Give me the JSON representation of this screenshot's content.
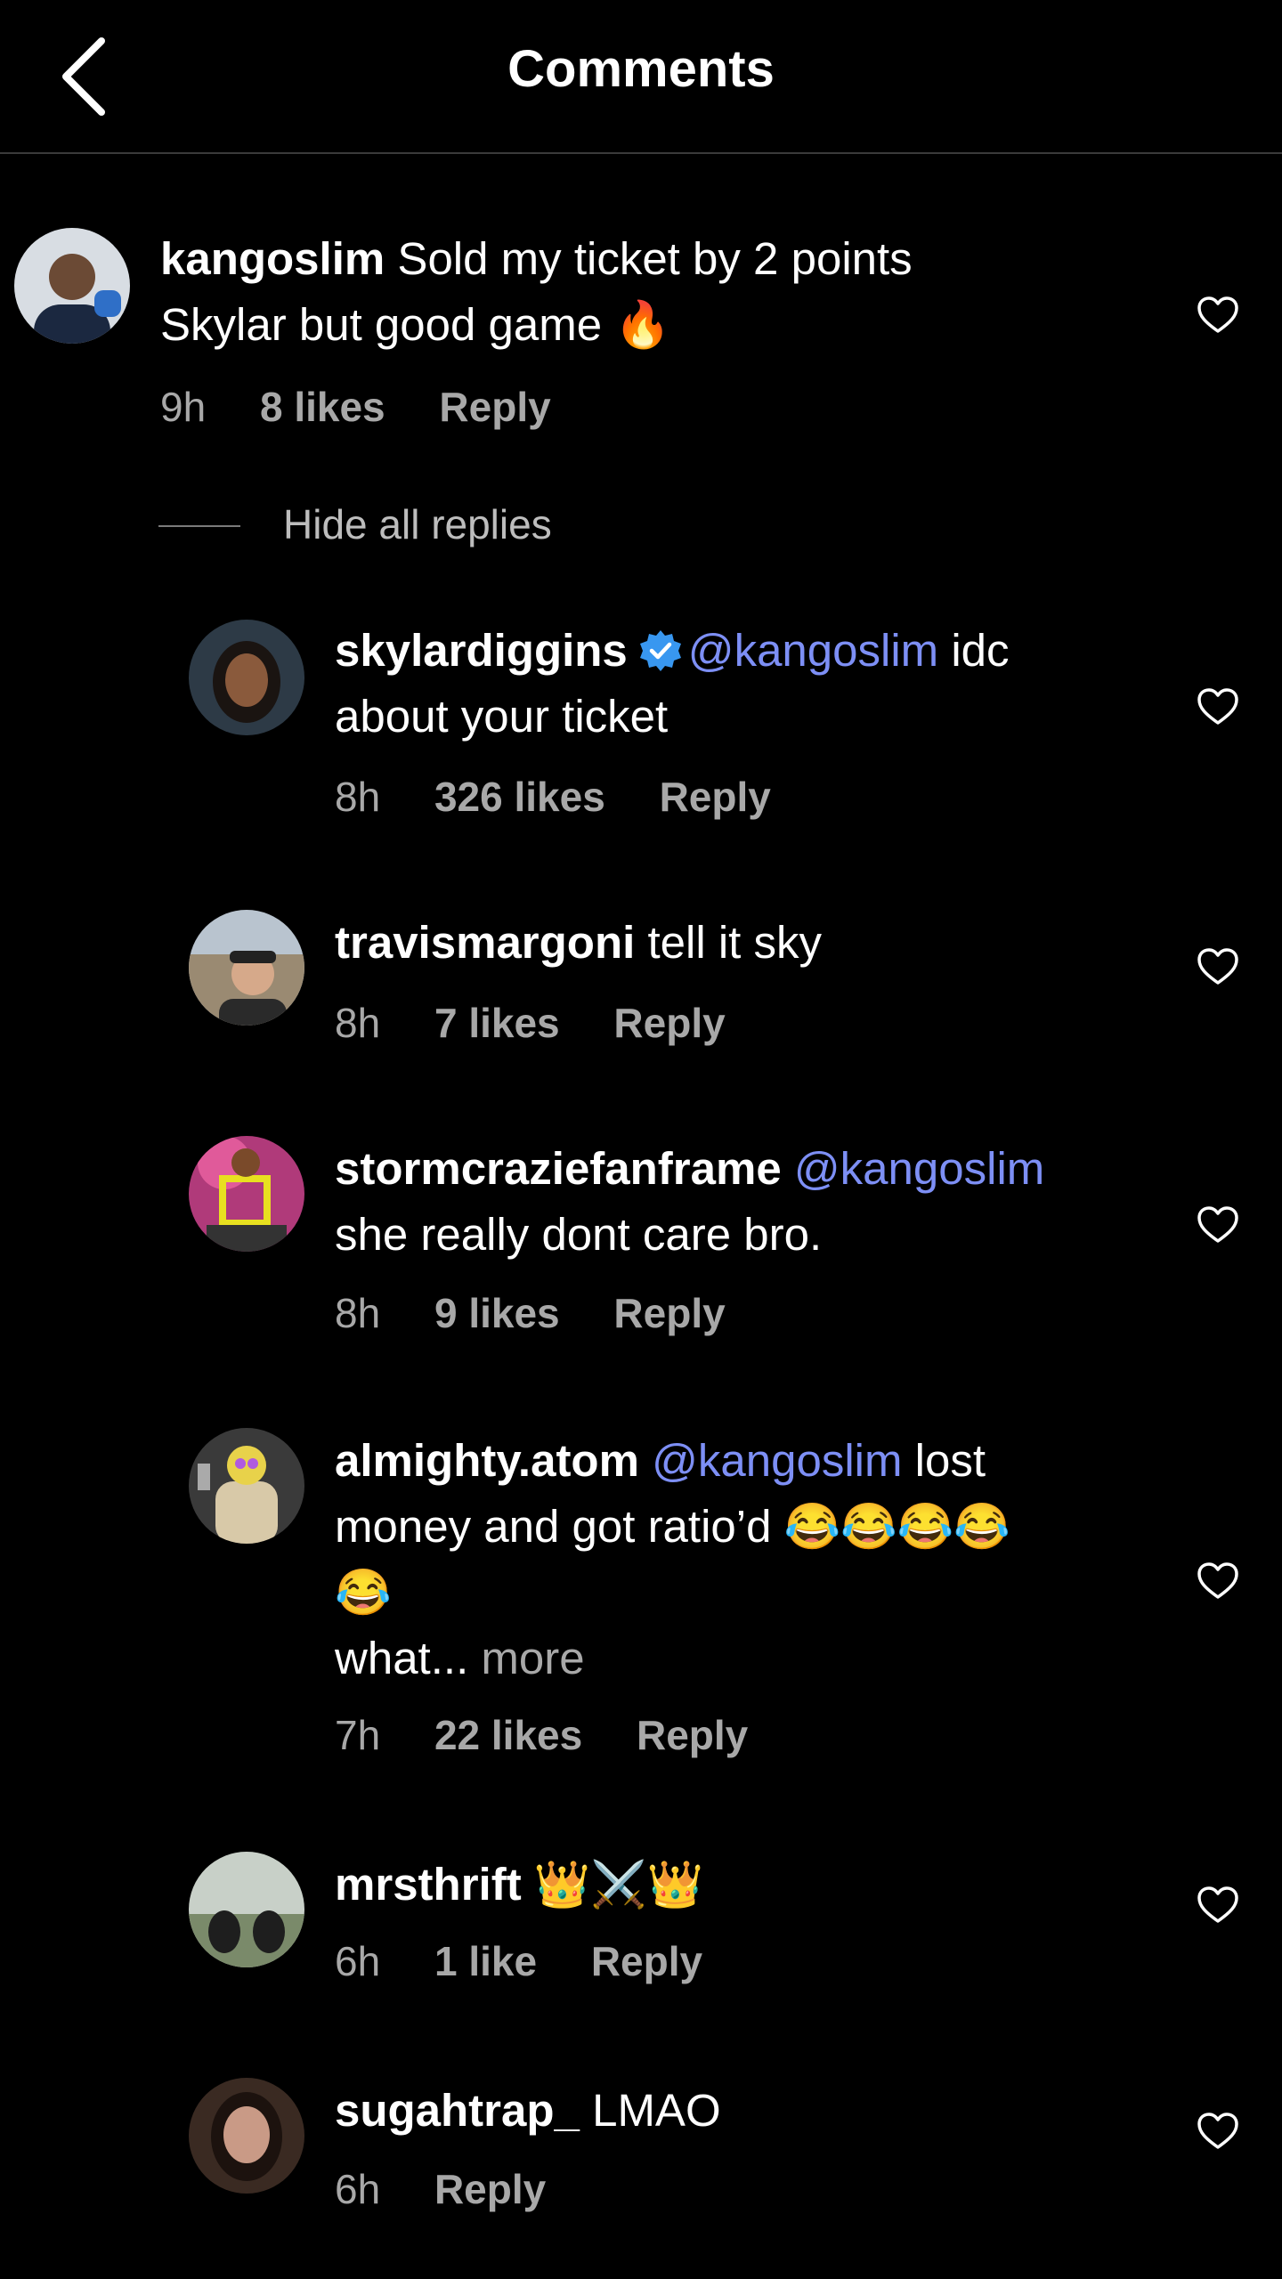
{
  "header": {
    "title": "Comments"
  },
  "hide_replies_label": "Hide all replies",
  "comments": [
    {
      "username": "kangoslim",
      "text": "Sold my ticket by 2 points",
      "text2": "Skylar but good game",
      "emoji": "🔥",
      "time": "9h",
      "likes": "8 likes",
      "reply": "Reply"
    },
    {
      "username": "skylardiggins",
      "verified": true,
      "mention": "@kangoslim",
      "text": "idc",
      "text2": "about your ticket",
      "time": "8h",
      "likes": "326 likes",
      "reply": "Reply"
    },
    {
      "username": "travismargoni",
      "text": "tell it sky",
      "time": "8h",
      "likes": "7 likes",
      "reply": "Reply"
    },
    {
      "username": "stormcraziefanframe",
      "mention": "@kangoslim",
      "text2": "she really dont care bro.",
      "time": "8h",
      "likes": "9 likes",
      "reply": "Reply"
    },
    {
      "username": "almighty.atom",
      "mention": "@kangoslim",
      "text": "lost",
      "text2": "money and got ratio’d",
      "emoji": "😂😂😂😂",
      "emoji2": "😂",
      "text3": "what...",
      "more": "more",
      "time": "7h",
      "likes": "22 likes",
      "reply": "Reply"
    },
    {
      "username": "mrsthrift",
      "emoji": "👑⚔️👑",
      "time": "6h",
      "likes": "1 like",
      "reply": "Reply"
    },
    {
      "username": "sugahtrap_",
      "text": "LMAO",
      "time": "6h",
      "reply": "Reply"
    }
  ],
  "colors": {
    "background": "#000000",
    "mention": "#7d8ff5",
    "meta": "#a8a8a8",
    "verified": "#3897f0"
  },
  "icons": {
    "back": "chevron-left-icon",
    "like": "heart-outline-icon",
    "verified": "verified-badge-icon"
  }
}
